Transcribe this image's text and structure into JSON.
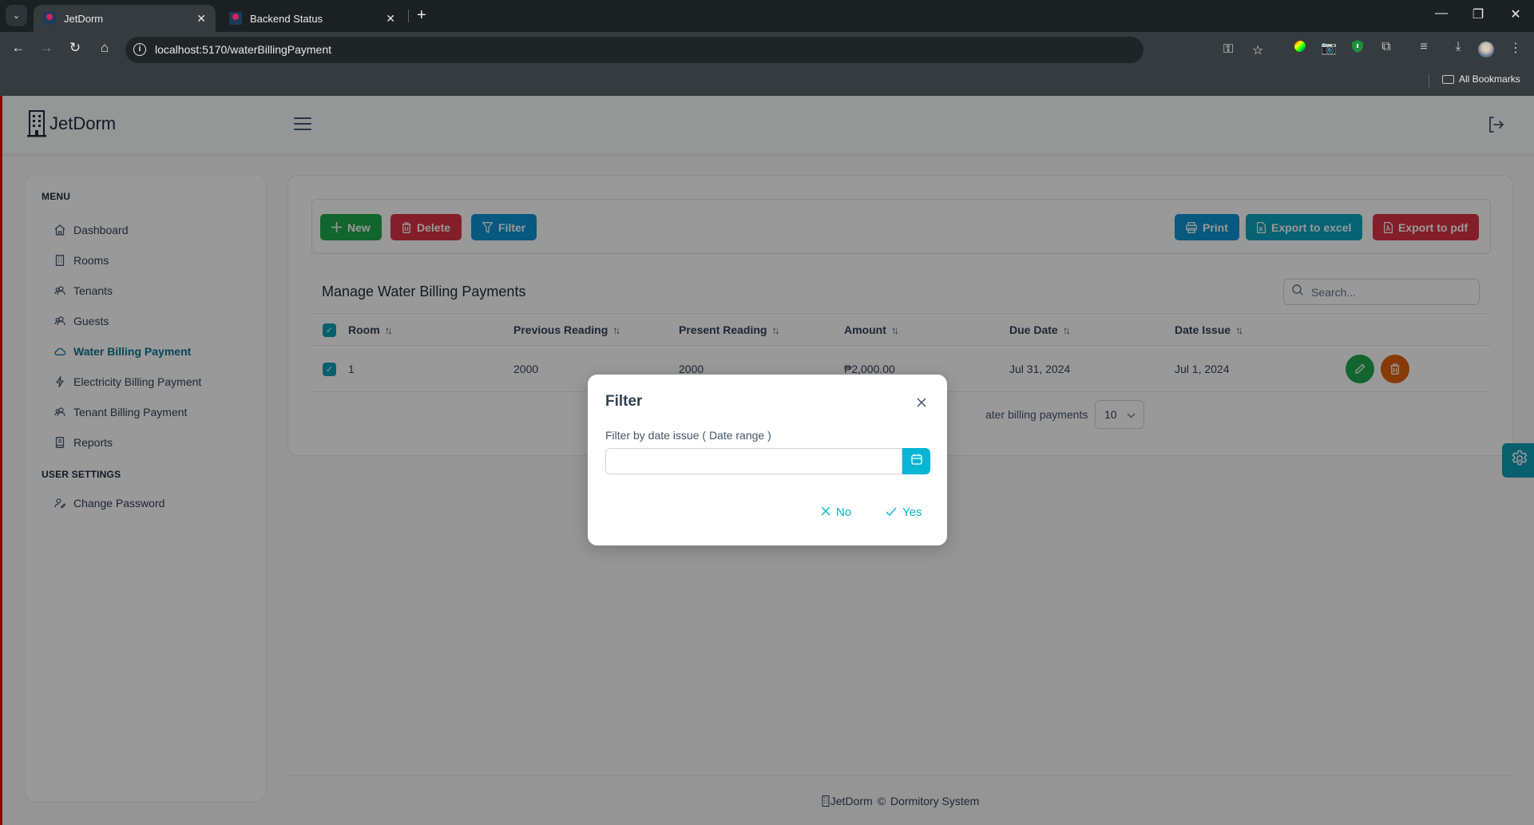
{
  "browser": {
    "tabs": [
      {
        "title": "JetDorm",
        "active": true
      },
      {
        "title": "Backend Status",
        "active": false
      }
    ],
    "url": "localhost:5170/waterBillingPayment",
    "bookmarks_label": "All Bookmarks"
  },
  "app": {
    "brand": "JetDorm",
    "accent_color": "#0e7490"
  },
  "sidebar": {
    "menu_heading": "MENU",
    "items": [
      {
        "label": "Dashboard",
        "icon": "home-icon",
        "active": false
      },
      {
        "label": "Rooms",
        "icon": "building-icon",
        "active": false
      },
      {
        "label": "Tenants",
        "icon": "users-icon",
        "active": false
      },
      {
        "label": "Guests",
        "icon": "users-icon",
        "active": false
      },
      {
        "label": "Water Billing Payment",
        "icon": "cloud-icon",
        "active": true
      },
      {
        "label": "Electricity Billing Payment",
        "icon": "bolt-icon",
        "active": false
      },
      {
        "label": "Tenant Billing Payment",
        "icon": "users-icon",
        "active": false
      },
      {
        "label": "Reports",
        "icon": "book-icon",
        "active": false
      }
    ],
    "settings_heading": "USER SETTINGS",
    "settings_items": [
      {
        "label": "Change Password",
        "icon": "user-edit-icon"
      }
    ]
  },
  "toolbar": {
    "new_label": "New",
    "delete_label": "Delete",
    "filter_label": "Filter",
    "print_label": "Print",
    "excel_label": "Export to excel",
    "pdf_label": "Export to pdf"
  },
  "table": {
    "title": "Manage Water Billing Payments",
    "search_placeholder": "Search...",
    "columns": [
      "Room",
      "Previous Reading",
      "Present Reading",
      "Amount",
      "Due Date",
      "Date Issue"
    ],
    "rows": [
      {
        "room": "1",
        "previous_reading": "2000",
        "present_reading": "2000",
        "amount": "₱2,000.00",
        "due_date": "Jul 31, 2024",
        "date_issue": "Jul 1, 2024",
        "selected": true
      }
    ],
    "all_selected": true,
    "paginator_text_visible": "ater billing payments",
    "rows_per_page": "10"
  },
  "footer": {
    "brand": "JetDorm",
    "copyright": "©",
    "system": "Dormitory System"
  },
  "modal": {
    "title": "Filter",
    "label": "Filter by date issue ( Date range )",
    "date_value": "",
    "no_label": "No",
    "yes_label": "Yes"
  }
}
